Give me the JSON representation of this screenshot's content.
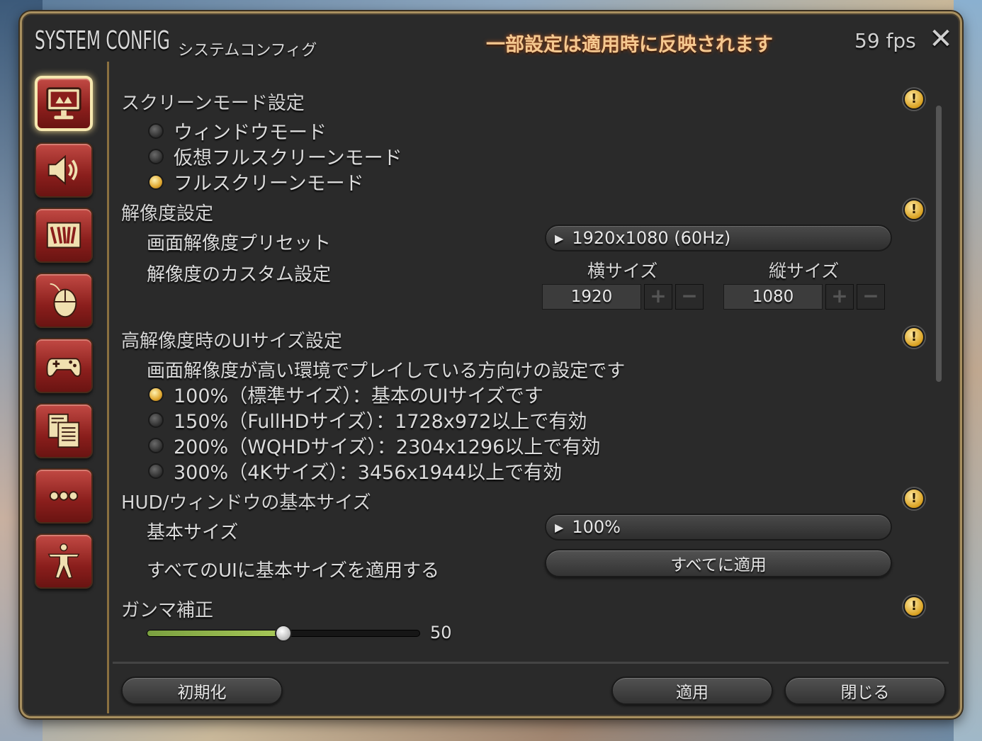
{
  "window": {
    "title_main": "SYSTEM CONFIG",
    "title_sub": "システムコンフィグ",
    "notice": "一部設定は適用時に反映されます",
    "fps": "59 fps"
  },
  "sidebar": {
    "items": [
      {
        "icon": "monitor-icon",
        "active": true
      },
      {
        "icon": "speaker-icon",
        "active": false
      },
      {
        "icon": "hotbar-icon",
        "active": false
      },
      {
        "icon": "mouse-icon",
        "active": false
      },
      {
        "icon": "gamepad-icon",
        "active": false
      },
      {
        "icon": "documents-icon",
        "active": false
      },
      {
        "icon": "more-icon",
        "active": false
      },
      {
        "icon": "accessibility-icon",
        "active": false
      }
    ]
  },
  "screen_mode": {
    "title": "スクリーンモード設定",
    "options": [
      "ウィンドウモード",
      "仮想フルスクリーンモード",
      "フルスクリーンモード"
    ],
    "selected_index": 2
  },
  "resolution": {
    "title": "解像度設定",
    "preset_label": "画面解像度プリセット",
    "preset_value": "1920x1080 (60Hz)",
    "custom_label": "解像度のカスタム設定",
    "width_label": "横サイズ",
    "height_label": "縦サイズ",
    "width_value": "1920",
    "height_value": "1080",
    "plus": "+",
    "minus": "−"
  },
  "ui_scale": {
    "title": "高解像度時のUIサイズ設定",
    "description": "画面解像度が高い環境でプレイしている方向けの設定です",
    "options": [
      "100%（標準サイズ）：基本のUIサイズです",
      "150%（FullHDサイズ）：1728x972以上で有効",
      "200%（WQHDサイズ）：2304x1296以上で有効",
      "300%（4Kサイズ）：3456x1944以上で有効"
    ],
    "selected_index": 0
  },
  "hud": {
    "title": "HUD/ウィンドウの基本サイズ",
    "base_size_label": "基本サイズ",
    "base_size_value": "100%",
    "apply_all_label": "すべてのUIに基本サイズを適用する",
    "apply_all_button": "すべてに適用"
  },
  "gamma": {
    "title": "ガンマ補正",
    "value": 50,
    "max": 100,
    "value_text": "50"
  },
  "footer": {
    "reset": "初期化",
    "apply": "適用",
    "close": "閉じる"
  },
  "warn_glyph": "!",
  "dropdown_arrow": "▶",
  "close_glyph": "✕"
}
